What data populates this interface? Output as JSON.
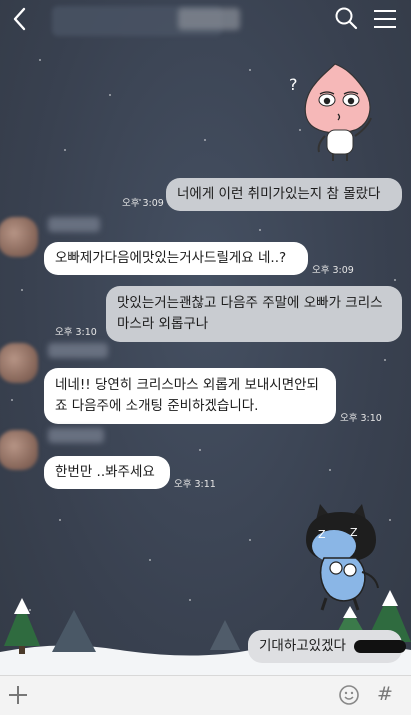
{
  "header": {
    "back_icon": "chevron-left-icon",
    "search_icon": "search-icon",
    "menu_icon": "hamburger-menu-icon"
  },
  "messages": [
    {
      "text": "너에게 이런 취미가있는지 참 몰랐다",
      "time": "오후 3:09",
      "direction": "outgoing"
    },
    {
      "text": "오빠제가다음에맛있는거사드릴게요 네..?",
      "time": "오후 3:09",
      "direction": "incoming"
    },
    {
      "line1": "맛있는거는괜찮고 다음주 주말에 오빠가 크리스",
      "line2": "마스라 외롭구나",
      "time": "오후 3:10",
      "direction": "outgoing"
    },
    {
      "line1": "네네!! 당연히 크리스마스 외롭게 보내시면안되",
      "line2": "죠 다음주에 소개팅 준비하겠습니다.",
      "time": "오후 3:10",
      "direction": "incoming"
    },
    {
      "text": "한번만 ..봐주세요",
      "time": "오후 3:11",
      "direction": "incoming"
    },
    {
      "text": "기대하고있겠다",
      "direction": "outgoing"
    }
  ],
  "input_bar": {
    "placeholder": "",
    "plus_icon": "plus-icon",
    "emoji_icon": "emoji-icon",
    "hash_label": "#"
  },
  "stickers": [
    {
      "name": "peach-character-sticker",
      "caption": "?"
    },
    {
      "name": "cat-character-sticker"
    }
  ],
  "colors": {
    "background": "#3b4350",
    "incoming_bubble": "#ffffff",
    "outgoing_bubble": "#c9ccd1",
    "timestamp": "#e6e6e6"
  }
}
